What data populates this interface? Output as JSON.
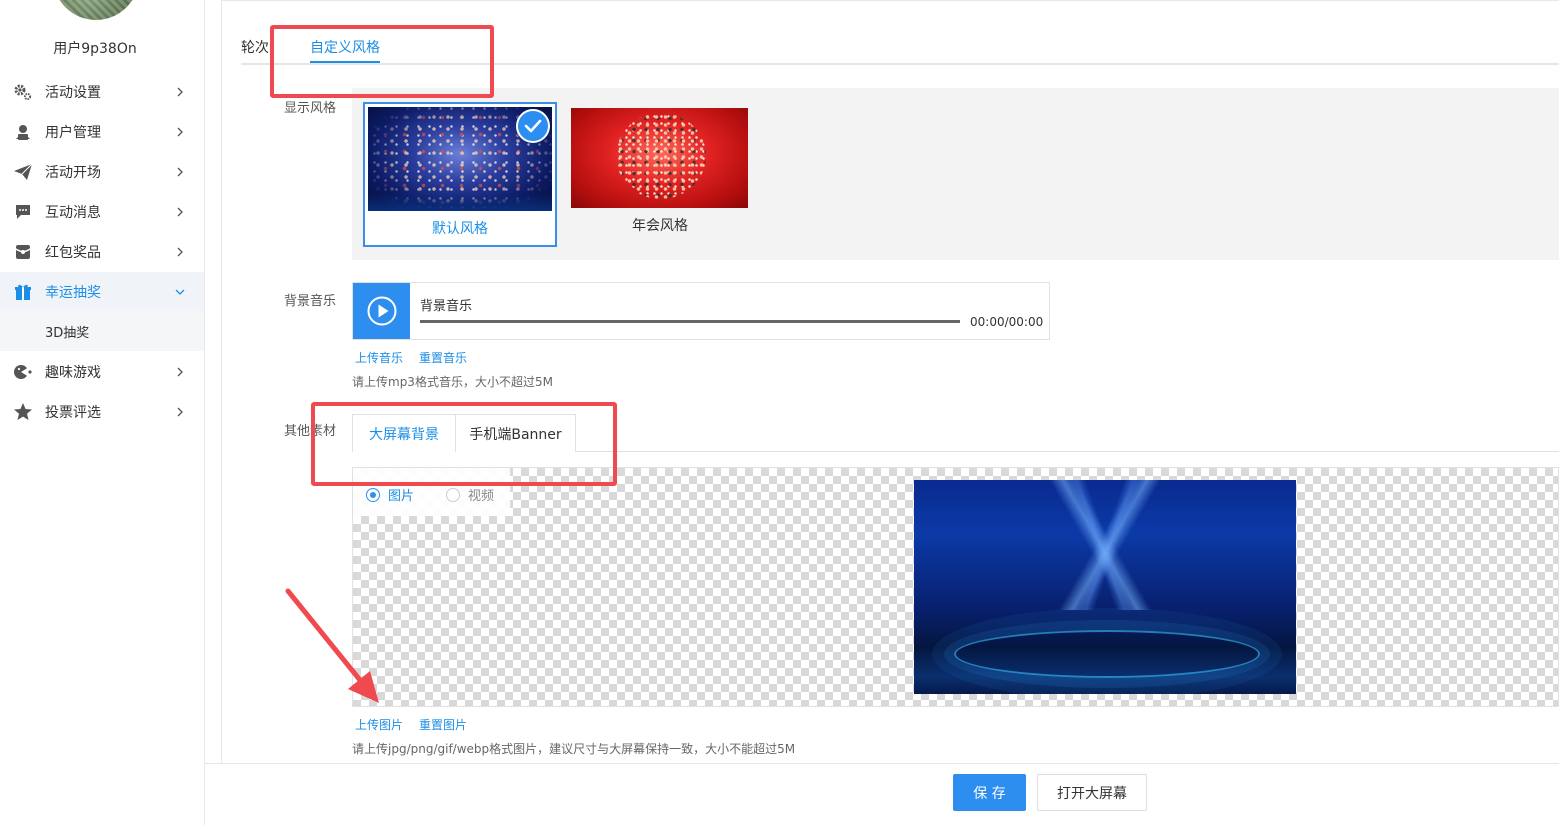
{
  "sidebar": {
    "username": "用户9p38On",
    "items": [
      {
        "label": "活动设置"
      },
      {
        "label": "用户管理"
      },
      {
        "label": "活动开场"
      },
      {
        "label": "互动消息"
      },
      {
        "label": "红包奖品"
      },
      {
        "label": "幸运抽奖"
      },
      {
        "label": "趣味游戏"
      },
      {
        "label": "投票评选"
      }
    ],
    "sub_item": "3D抽奖",
    "active_color": "#1c8ee6"
  },
  "tabs": {
    "items": [
      {
        "label": "轮次"
      },
      {
        "label": "自定义风格"
      }
    ],
    "active": "自定义风格"
  },
  "display_style": {
    "label": "显示风格",
    "options": [
      {
        "label": "默认风格",
        "selected": true
      },
      {
        "label": "年会风格",
        "selected": false
      }
    ]
  },
  "music": {
    "label": "背景音乐",
    "title": "背景音乐",
    "time": "00:00/00:00",
    "upload": "上传音乐",
    "reset": "重置音乐",
    "hint": "请上传mp3格式音乐，大小不超过5M"
  },
  "material": {
    "label": "其他素材",
    "tabs": [
      {
        "label": "大屏幕背景"
      },
      {
        "label": "手机端Banner"
      }
    ],
    "radio": [
      {
        "label": "图片",
        "checked": true
      },
      {
        "label": "视频",
        "checked": false
      }
    ],
    "upload": "上传图片",
    "reset": "重置图片",
    "hint": "请上传jpg/png/gif/webp格式图片，建议尺寸与大屏幕保持一致，大小不能超过5M"
  },
  "footer": {
    "save": "保 存",
    "open_screen": "打开大屏幕"
  },
  "colors": {
    "primary": "#2d8ef0",
    "annotation": "#ee4a4f"
  }
}
